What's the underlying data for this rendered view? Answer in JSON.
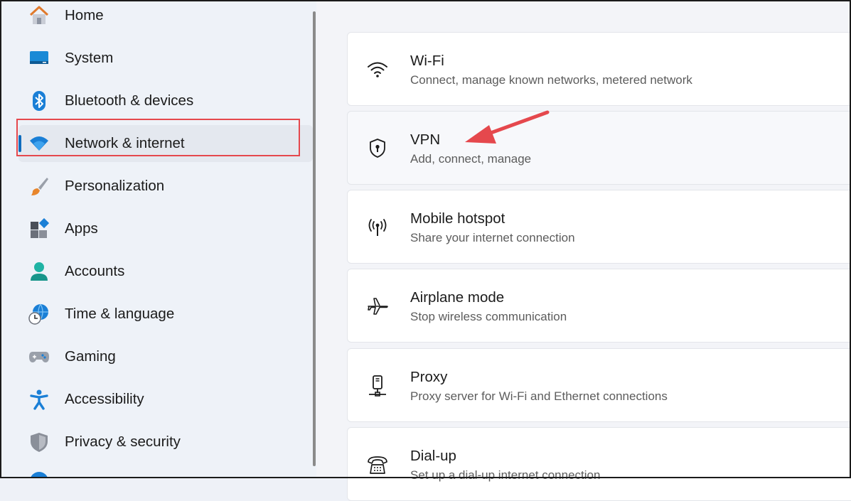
{
  "sidebar": {
    "items": [
      {
        "label": "Home",
        "icon": "home-icon"
      },
      {
        "label": "System",
        "icon": "monitor-icon"
      },
      {
        "label": "Bluetooth & devices",
        "icon": "bluetooth-icon"
      },
      {
        "label": "Network & internet",
        "icon": "wifi-icon"
      },
      {
        "label": "Personalization",
        "icon": "brush-icon"
      },
      {
        "label": "Apps",
        "icon": "apps-icon"
      },
      {
        "label": "Accounts",
        "icon": "person-icon"
      },
      {
        "label": "Time & language",
        "icon": "globe-clock-icon"
      },
      {
        "label": "Gaming",
        "icon": "gamepad-icon"
      },
      {
        "label": "Accessibility",
        "icon": "accessibility-icon"
      },
      {
        "label": "Privacy & security",
        "icon": "shield-icon"
      }
    ],
    "active_item": "Network & internet"
  },
  "main": {
    "cards": [
      {
        "title": "Wi-Fi",
        "subtitle": "Connect, manage known networks, metered network",
        "icon": "wifi-icon"
      },
      {
        "title": "VPN",
        "subtitle": "Add, connect, manage",
        "icon": "vpn-shield-icon"
      },
      {
        "title": "Mobile hotspot",
        "subtitle": "Share your internet connection",
        "icon": "hotspot-icon"
      },
      {
        "title": "Airplane mode",
        "subtitle": "Stop wireless communication",
        "icon": "airplane-icon"
      },
      {
        "title": "Proxy",
        "subtitle": "Proxy server for Wi-Fi and Ethernet connections",
        "icon": "proxy-icon"
      },
      {
        "title": "Dial-up",
        "subtitle": "Set up a dial-up internet connection",
        "icon": "dialup-phone-icon"
      }
    ]
  },
  "annotation": {
    "arrow_color": "#e5484d",
    "highlight_color": "#e5484d"
  },
  "colors": {
    "accent": "#0f6cbd"
  }
}
